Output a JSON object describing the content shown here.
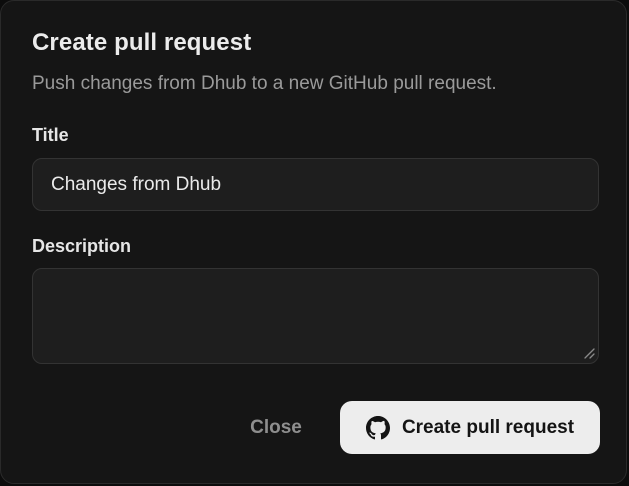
{
  "dialog": {
    "title": "Create pull request",
    "subtitle": "Push changes from Dhub to a new GitHub pull request."
  },
  "form": {
    "title_label": "Title",
    "title_value": "Changes from Dhub",
    "description_label": "Description",
    "description_value": ""
  },
  "actions": {
    "close_label": "Close",
    "create_label": "Create pull request",
    "create_icon": "github-icon"
  },
  "colors": {
    "background": "#151515",
    "input_background": "#1e1e1e",
    "primary_button": "#ededed"
  }
}
